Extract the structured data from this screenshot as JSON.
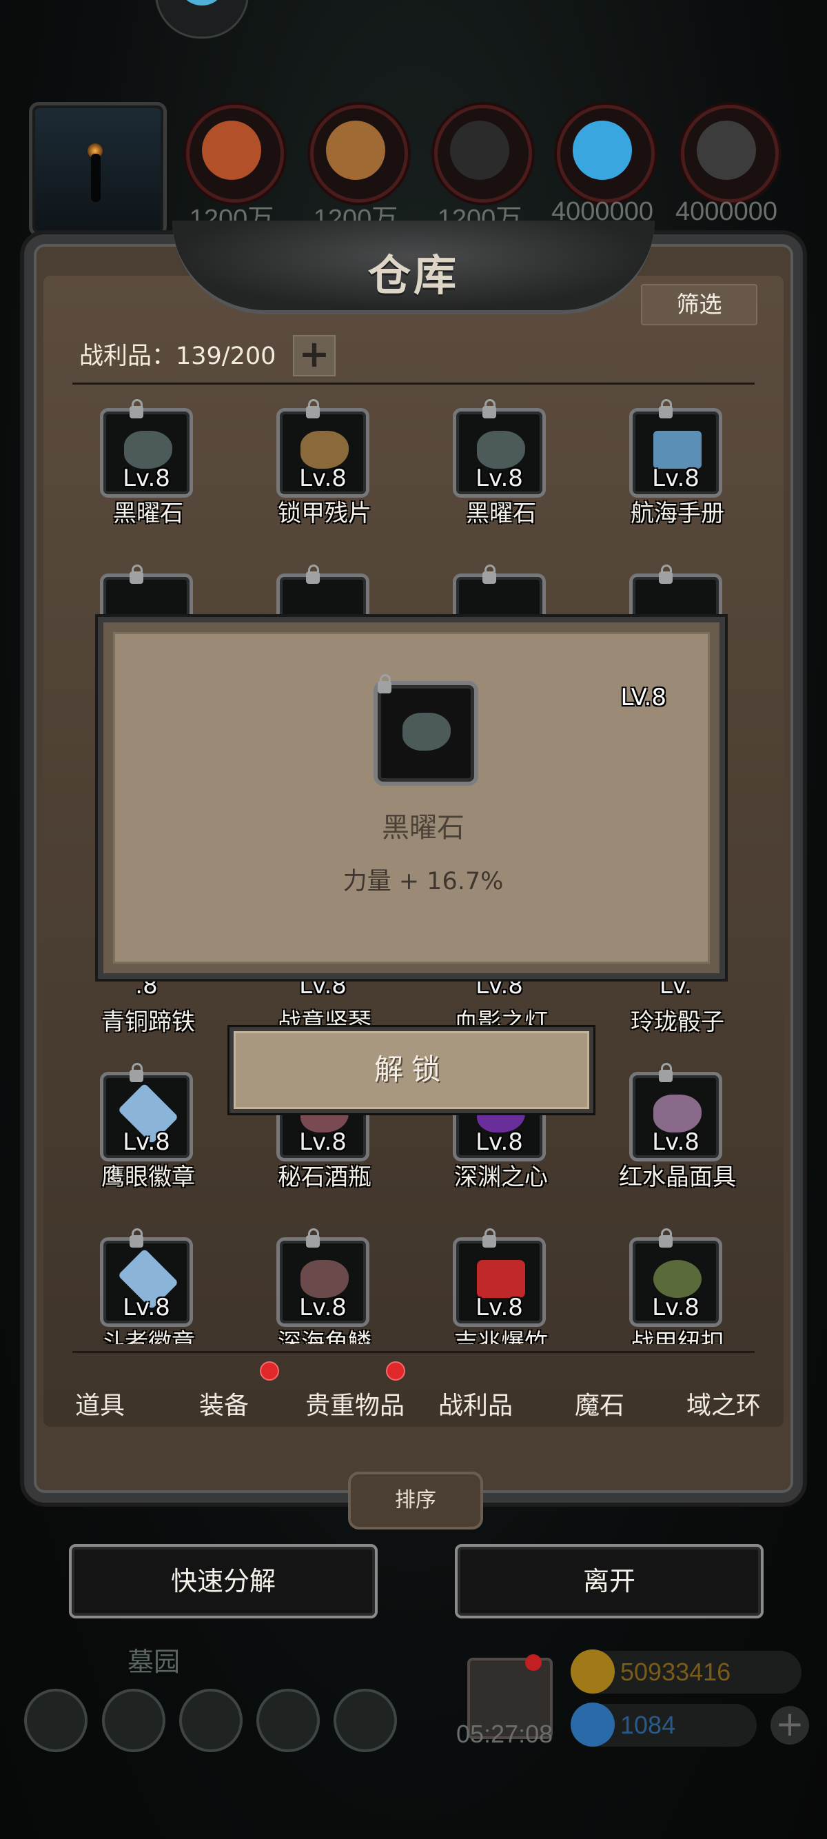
{
  "resources": [
    {
      "icon": "meat-icon",
      "amount": "1200万",
      "color": "#b2502a"
    },
    {
      "icon": "wood-icon",
      "amount": "1200万",
      "color": "#a06a34"
    },
    {
      "icon": "stone-icon",
      "amount": "1200万",
      "color": "#2b2b2b"
    },
    {
      "icon": "crystal-icon",
      "amount": "4000000",
      "color": "#3aa6e0"
    },
    {
      "icon": "iron-icon",
      "amount": "4000000",
      "color": "#3c3c3c"
    }
  ],
  "warehouse": {
    "title": "仓库",
    "filter_label": "筛选",
    "count_label": "战利品：139/200",
    "plus": "+"
  },
  "grid": {
    "row1": [
      {
        "lv": "Lv.8",
        "name": "黑曜石",
        "icon": "obsidian-icon",
        "color": "#4c5a5a"
      },
      {
        "lv": "Lv.8",
        "name": "锁甲残片",
        "icon": "chain-fragment-icon",
        "color": "#8a6a3a"
      },
      {
        "lv": "Lv.8",
        "name": "黑曜石",
        "icon": "obsidian-icon",
        "color": "#4c5a5a"
      },
      {
        "lv": "Lv.8",
        "name": "航海手册",
        "icon": "book-icon",
        "color": "#5b8fb5"
      }
    ],
    "row4": [
      {
        "lv": ".8",
        "name": "青铜蹄铁"
      },
      {
        "lv": "Lv.8",
        "name": "战意竖琴"
      },
      {
        "lv": "Lv.8",
        "name": "血影之灯"
      },
      {
        "lv": "Lv.",
        "name": "玲珑骰子"
      }
    ],
    "row5": [
      {
        "lv": "Lv.8",
        "name": "鹰眼徽章",
        "icon": "eagle-badge-icon",
        "color": "#8ab4d8"
      },
      {
        "lv": "Lv.8",
        "name": "秘石酒瓶",
        "icon": "bottle-icon",
        "color": "#7a4a52"
      },
      {
        "lv": "Lv.8",
        "name": "深渊之心",
        "icon": "abyss-heart-icon",
        "color": "#6a2e9a"
      },
      {
        "lv": "Lv.8",
        "name": "红水晶面具",
        "icon": "mask-icon",
        "color": "#8a6a8a"
      }
    ],
    "row6": [
      {
        "lv": "Lv.8",
        "name": "斗者徽章",
        "icon": "fighter-badge-icon",
        "color": "#8ab4d8"
      },
      {
        "lv": "Lv.8",
        "name": "深海角鳞",
        "icon": "scale-icon",
        "color": "#6a4a4a"
      },
      {
        "lv": "Lv.8",
        "name": "吉兆爆竹",
        "icon": "firecracker-icon",
        "color": "#c0282a"
      },
      {
        "lv": "Lv.8",
        "name": "战甲纽扣",
        "icon": "button-icon",
        "color": "#5a6a3a"
      }
    ]
  },
  "tabs": [
    {
      "label": "道具",
      "dot": false
    },
    {
      "label": "装备",
      "dot": true
    },
    {
      "label": "贵重物品",
      "dot": true
    },
    {
      "label": "战利品",
      "dot": false
    },
    {
      "label": "魔石",
      "dot": false
    },
    {
      "label": "域之环",
      "dot": false
    }
  ],
  "sort_label": "排序",
  "buttons": {
    "quick_decompose": "快速分解",
    "leave": "离开"
  },
  "modal": {
    "lv": "LV.8",
    "item_name": "黑曜石",
    "stat": "力量 + 16.7%",
    "icon": "obsidian-icon",
    "unlock_label": "解锁"
  },
  "bottom": {
    "label": "墓园",
    "timer": "05:27:08",
    "gold": "50933416",
    "gems": "1084",
    "gold_color": "#a07a18",
    "gem_color": "#2a6aa8"
  }
}
